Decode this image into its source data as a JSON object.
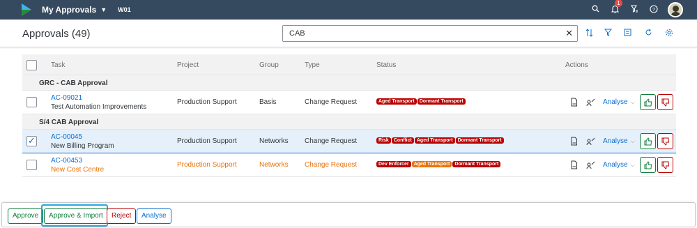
{
  "shell": {
    "title": "My Approvals",
    "caret": "▼",
    "subtitle": "W01",
    "notification_count": "1",
    "icons": [
      "search-icon",
      "bell-icon",
      "filter-funnel-icon",
      "help-icon",
      "avatar"
    ]
  },
  "header": {
    "title": "Approvals (49)",
    "search_value": "CAB",
    "clear_glyph": "✕",
    "tools": [
      "sort-icon",
      "filter-icon",
      "group-icon",
      "refresh-icon",
      "settings-icon"
    ]
  },
  "table": {
    "columns": {
      "task": "Task",
      "project": "Project",
      "group": "Group",
      "type": "Type",
      "status": "Status",
      "actions": "Actions"
    },
    "groups": [
      {
        "title": "GRC - CAB Approval",
        "rows": [
          {
            "id": "AC-09021",
            "name": "Test Automation Improvements",
            "project": "Production Support",
            "group": "Basis",
            "type": "Change Request",
            "tags": [
              {
                "label": "Aged Transport",
                "color": "#bb0000"
              },
              {
                "label": "Dormant Transport",
                "color": "#bb0000"
              }
            ],
            "analyse": "Analyse",
            "selected": false,
            "warning": false
          }
        ]
      },
      {
        "title": "S/4 CAB Approval",
        "rows": [
          {
            "id": "AC-00045",
            "name": "New Billing Program",
            "project": "Production Support",
            "group": "Networks",
            "type": "Change Request",
            "tags": [
              {
                "label": "Risk",
                "color": "#bb0000"
              },
              {
                "label": "Conflict",
                "color": "#bb0000"
              },
              {
                "label": "Aged Transport",
                "color": "#bb0000"
              },
              {
                "label": "Dormant Transport",
                "color": "#bb0000"
              }
            ],
            "analyse": "Analyse",
            "selected": true,
            "warning": false
          },
          {
            "id": "AC-00453",
            "name": "New Cost Centre",
            "project": "Production Support",
            "group": "Networks",
            "type": "Change Request",
            "tags": [
              {
                "label": "Dev Enforcer",
                "color": "#bb0000"
              },
              {
                "label": "Aged Transport",
                "color": "#e9730c"
              },
              {
                "label": "Dormant Transport",
                "color": "#bb0000"
              }
            ],
            "analyse": "Analyse",
            "selected": false,
            "warning": true
          }
        ]
      }
    ]
  },
  "footer": {
    "approve": "Approve",
    "approve_import": "Approve & Import",
    "reject": "Reject",
    "analyse": "Analyse"
  },
  "colors": {
    "shell_bg": "#354a5f",
    "link": "#0a6ed1",
    "positive": "#107e3e",
    "negative": "#bb0000",
    "critical": "#e9730c",
    "focus": "#2aa6d9"
  }
}
